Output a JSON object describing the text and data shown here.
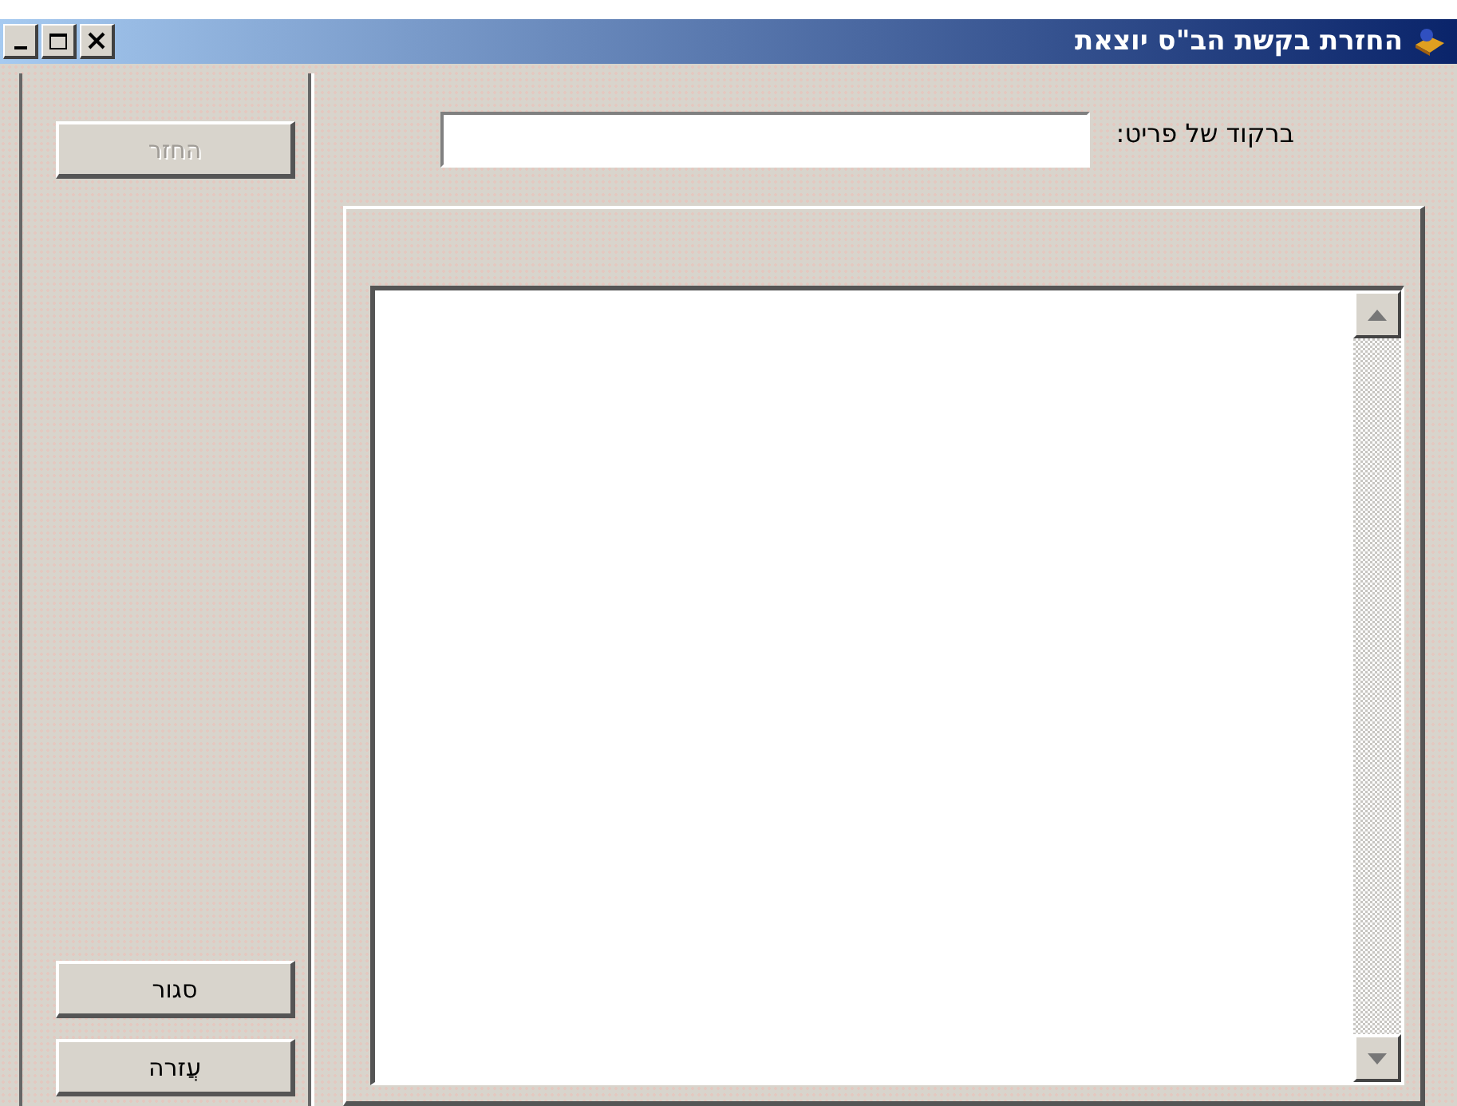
{
  "window": {
    "title": "החזרת בקשת הב\"ס יוצאת"
  },
  "top_buttons": [
    {
      "label": "החזר",
      "disabled": true
    }
  ],
  "bottom_buttons": [
    {
      "label": "סגור",
      "disabled": false
    },
    {
      "label": "עֲזרה",
      "disabled": false
    }
  ],
  "barcode_field": {
    "label": "ברקוד של פריט:"
  }
}
